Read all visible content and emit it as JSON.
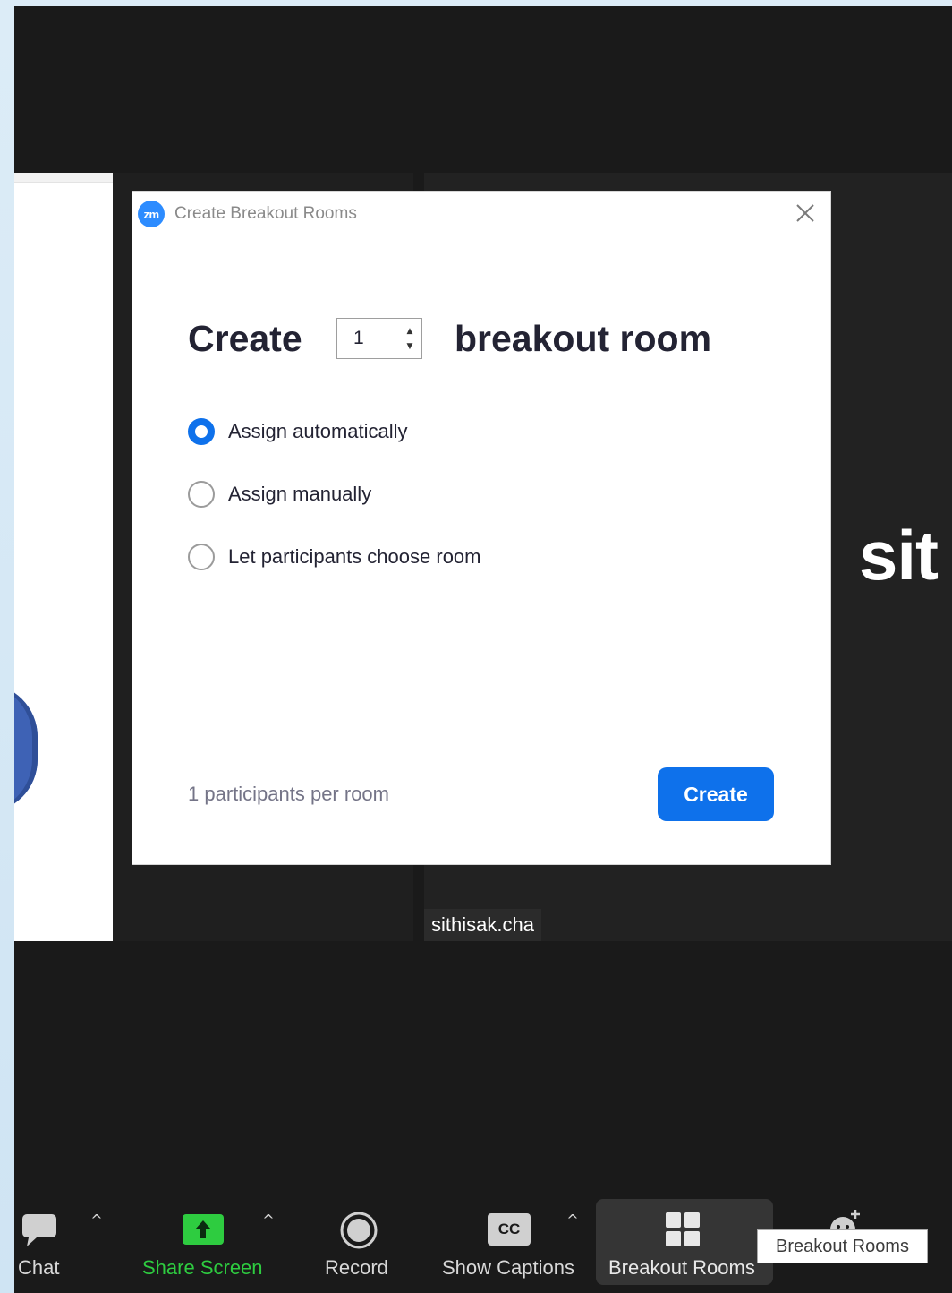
{
  "dialog": {
    "logo_text": "zm",
    "title": "Create Breakout Rooms",
    "create_word": "Create",
    "room_count": "1",
    "room_word": "breakout room",
    "options": [
      {
        "label": "Assign automatically",
        "selected": true
      },
      {
        "label": "Assign manually",
        "selected": false
      },
      {
        "label": "Let participants choose room",
        "selected": false
      }
    ],
    "per_room_text": "1 participants per room",
    "create_button": "Create"
  },
  "video": {
    "big_name": "sit",
    "name_tag": "sithisak.cha"
  },
  "toolbar": {
    "chat": "Chat",
    "share_screen": "Share Screen",
    "record": "Record",
    "show_captions": "Show Captions",
    "cc_glyph": "CC",
    "breakout_rooms": "Breakout Rooms",
    "tooltip": "Breakout Rooms"
  },
  "colors": {
    "accent": "#0e71eb",
    "share_green": "#2ecc40",
    "background": "#1a1a1a"
  }
}
